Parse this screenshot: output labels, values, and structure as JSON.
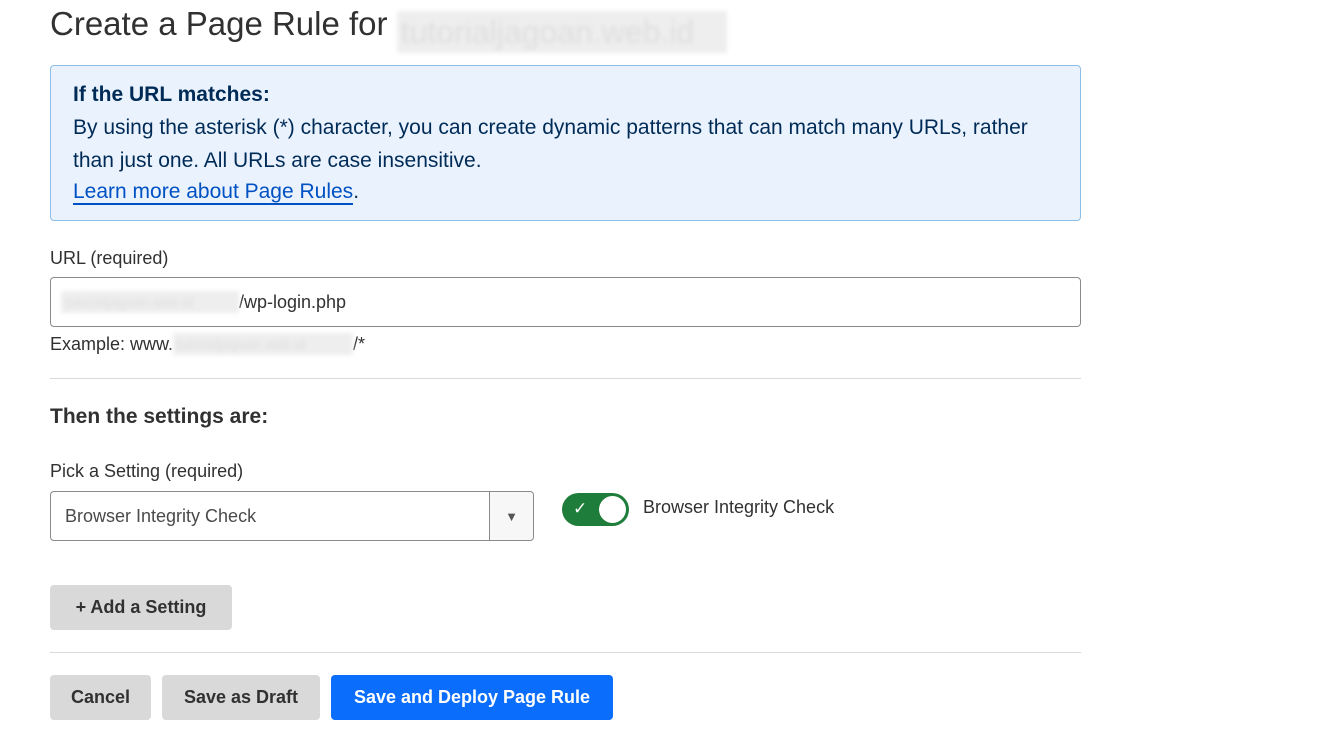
{
  "header": {
    "title_prefix": "Create a Page Rule for",
    "domain_blurred": "tutorialjagoan.web.id"
  },
  "info": {
    "title": "If the URL matches:",
    "description": "By using the asterisk (*) character, you can create dynamic patterns that can match many URLs, rather than just one. All URLs are case insensitive.",
    "link_text": "Learn more about Page Rules",
    "link_suffix": "."
  },
  "url_field": {
    "label": "URL (required)",
    "value_domain_blurred": "tutorialjagoan.web.id",
    "value_path": "/wp-login.php",
    "example_prefix": "Example: www.",
    "example_domain_blurred": "tutorialjagoan.web.id",
    "example_suffix": "/*"
  },
  "settings": {
    "heading": "Then the settings are:",
    "pick_label": "Pick a Setting (required)",
    "selected": "Browser Integrity Check",
    "toggle_label": "Browser Integrity Check",
    "toggle_on": true,
    "toggle_check_glyph": "✓",
    "caret_glyph": "▼",
    "add_button": "+ Add a Setting"
  },
  "actions": {
    "cancel": "Cancel",
    "save_draft": "Save as Draft",
    "save_deploy": "Save and Deploy Page Rule"
  },
  "colors": {
    "info_bg": "#eaf3fd",
    "info_border": "#8fbde9",
    "info_text": "#002b57",
    "link": "#0051c3",
    "toggle_on": "#1e7d3a",
    "primary_button": "#0a6dfb",
    "secondary_button": "#d9d9d9"
  }
}
